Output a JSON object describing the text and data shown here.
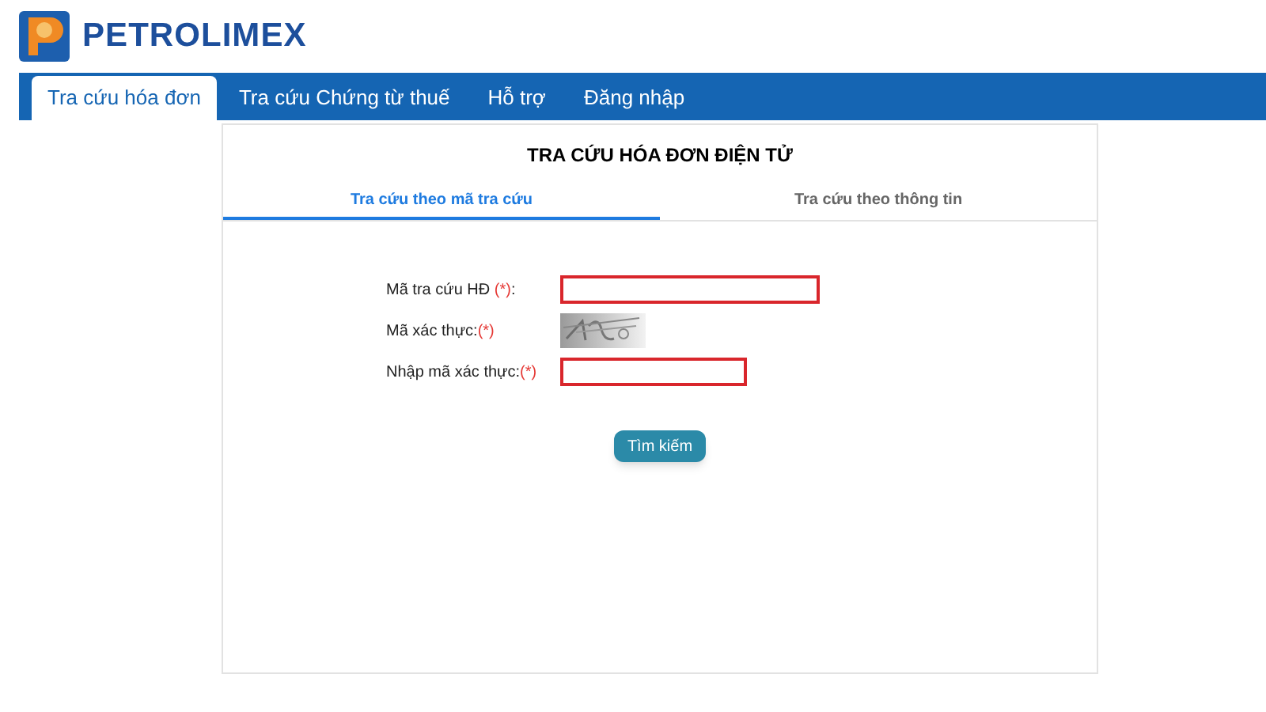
{
  "brand": {
    "name": "PETROLIMEX"
  },
  "nav": [
    {
      "label": "Tra cứu hóa đơn",
      "selected": true
    },
    {
      "label": "Tra cứu Chứng từ thuế",
      "selected": false
    },
    {
      "label": "Hỗ trợ",
      "selected": false
    },
    {
      "label": "Đăng nhập",
      "selected": false
    }
  ],
  "card": {
    "title": "TRA CỨU HÓA ĐƠN ĐIỆN TỬ",
    "tabs": [
      {
        "label": "Tra cứu theo mã tra cứu",
        "selected": true
      },
      {
        "label": "Tra cứu theo thông tin",
        "selected": false
      }
    ],
    "fields": [
      {
        "kind": "code",
        "label": "Mã tra cứu HĐ ",
        "required": "(*)",
        "suffix": ":"
      },
      {
        "kind": "captcha",
        "label": "Mã xác thực:",
        "required": "(*)"
      },
      {
        "kind": "answer",
        "label": "Nhập mã xác thực:",
        "required": "(*)"
      }
    ],
    "button": "Tìm kiếm"
  }
}
